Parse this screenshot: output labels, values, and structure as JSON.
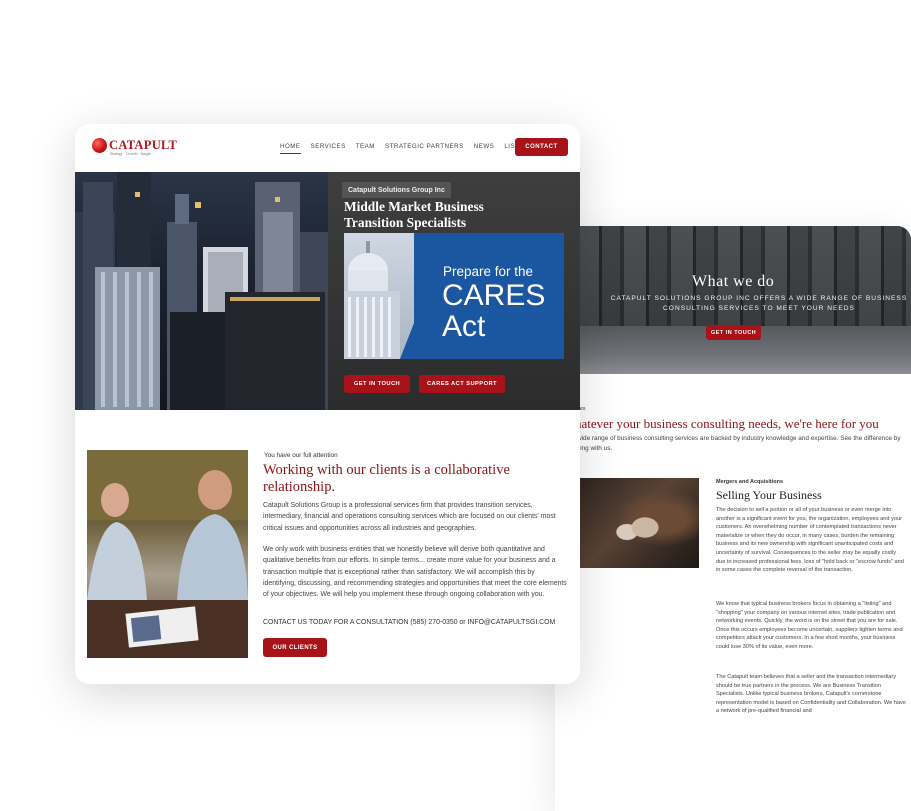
{
  "back": {
    "hero": {
      "title": "What we do",
      "subtitle_line1": "CATAPULT SOLUTIONS GROUP INC OFFERS A WIDE RANGE OF BUSINESS",
      "subtitle_line2": "CONSULTING SERVICES TO MEET YOUR NEEDS",
      "button": "GET IN TOUCH"
    },
    "services_eyebrow": "ces",
    "services_heading": "hatever your business consulting needs, we're here for you",
    "services_intro_line1": "wide range of business consulting services are backed by industry knowledge and expertise. See the difference by",
    "services_intro_line2": "king with us.",
    "ma": {
      "eyebrow": "Mergers and Acquisitions",
      "heading": "Selling Your Business",
      "p1": "The decision to sell a portion or all of your business or even merge into another is a significant event for you, the organization, employees and your customers. An overwhelming number of contemplated transactions never materialize or when they do occur, in many cases, burden the remaining business and its new ownership with significant unanticipated costs and uncertainty of survival. Consequences to the seller may be equally costly due to increased professional fees, loss of \"hold back or \"escrow funds\" and in some cases the complete reversal of the transaction.",
      "p2": "We know that typical business brokers focus in obtaining a \"listing\" and \"shopping\" your company on various internet sites, trade publication and networking events. Quickly, the word is on the street that you are for sale. Once this occurs employees become uncertain, suppliers tighten terms and competitors attack your customers. In a few short months, your business could lose 30% of its value, even more.",
      "p3": "The Catapult team believes that a seller and the transaction intermediary should be true partners in the process. We are Business Transition Specialists. Unlike typical business brokers, Catapult's cornerstone representation model is based on Confidentiality and Collaboration. We have a network of pre-qualified financial and"
    }
  },
  "front": {
    "logo": {
      "text": "CATAPULT",
      "tagline": "Strategy · Growth · Insight"
    },
    "nav": {
      "items": [
        "HOME",
        "SERVICES",
        "TEAM",
        "STRATEGIC PARTNERS",
        "NEWS",
        "LISTINGS"
      ],
      "listings_caret": "⌄",
      "contact": "CONTACT"
    },
    "hero": {
      "company": "Catapult Solutions Group Inc",
      "title_line1": "Middle Market Business",
      "title_line2": "Transition Specialists",
      "cares_line1": "Prepare for the",
      "cares_line2": "CARES",
      "cares_line3": "Act",
      "button1": "GET IN TOUCH",
      "button2": "CARES ACT SUPPORT"
    },
    "collab": {
      "eyebrow": "You have our full attention",
      "heading_line1": "Working with our clients is a collaborative",
      "heading_line2": "relationship.",
      "p1": "Catapult Solutions Group is a professional services firm that provides transition services, intermediary, financial and operations consulting services which are focused on our clients' most critical issues and opportunities across all industries and geographies.",
      "p2": "We only work with business entities that we honestly believe will derive both quantitative and qualitative benefits from our efforts. In simple terms... create more value for your business and a transaction multiple that is exceptional rather than satisfactory. We will accomplish this by identifying, discussing, and recommending strategies and opportunities that meet the core elements of your objectives. We will help you implement these through ongoing collaboration with you.",
      "contact": "CONTACT US TODAY FOR A CONSULTATION (585) 270-0350 or INFO@CATAPULTSGI.COM",
      "button": "OUR CLIENTS"
    }
  },
  "colors": {
    "brand_red": "#a8131a",
    "heading_red": "#8e1316",
    "cares_blue": "#1b56a0"
  }
}
